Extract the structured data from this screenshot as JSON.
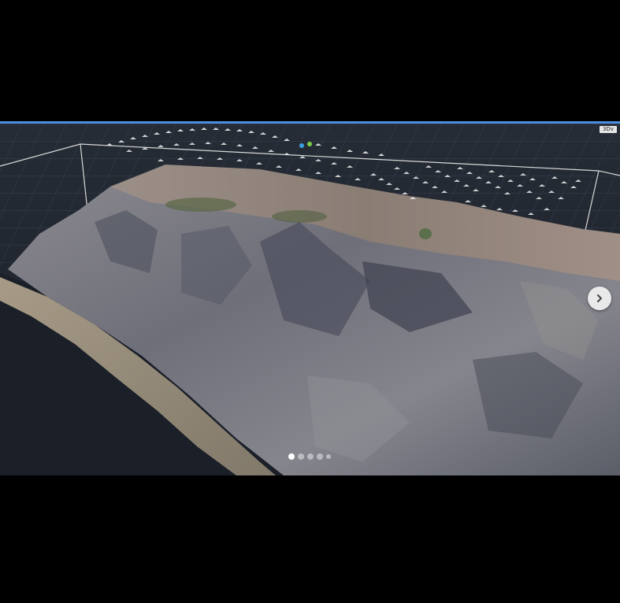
{
  "viewer": {
    "badge_label": "3Dv",
    "next_button": {
      "icon": "chevron-right-icon"
    },
    "carousel": {
      "count": 5,
      "active_index": 0
    }
  },
  "colors": {
    "background": "#000000",
    "viewport": "#1f2530",
    "accent_line": "#4a8ee0",
    "grid": "#3b4452",
    "bounding_box": "#d8d8d8"
  }
}
